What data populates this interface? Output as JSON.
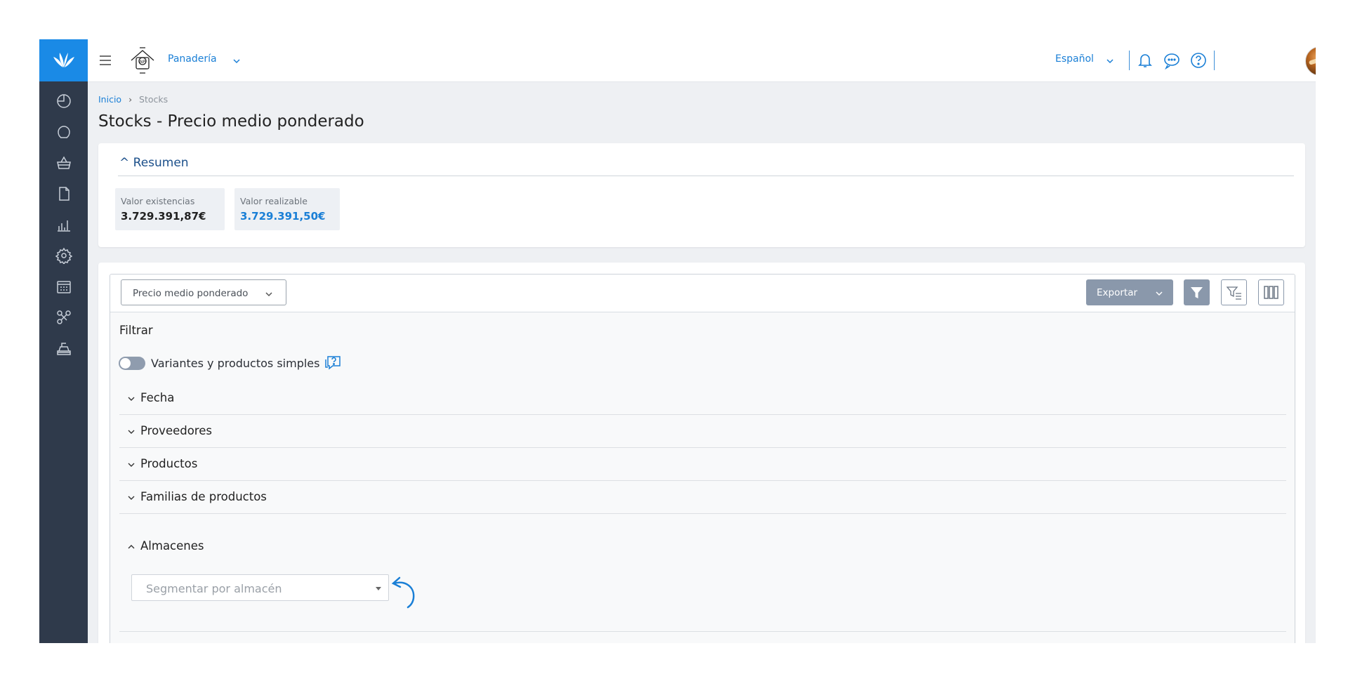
{
  "topbar": {
    "company": "Panadería",
    "language": "Español"
  },
  "breadcrumb": {
    "home": "Inicio",
    "separator": "›",
    "current": "Stocks"
  },
  "page": {
    "title": "Stocks - Precio medio ponderado"
  },
  "summary": {
    "toggle_label": "^ Resumen",
    "stats": [
      {
        "label": "Valor existencias",
        "value": "3.729.391,87€",
        "color": "#222222"
      },
      {
        "label": "Valor realizable",
        "value": "3.729.391,50€",
        "color": "#1a7fd6"
      }
    ]
  },
  "toolbar": {
    "report_select": "Precio medio ponderado",
    "export_label": "Exportar"
  },
  "filters": {
    "title": "Filtrar",
    "toggle_label": "Variantes y productos simples",
    "sections": [
      "Fecha",
      "Proveedores",
      "Productos",
      "Familias de productos",
      "Almacenes"
    ],
    "warehouse_placeholder": "Segmentar por almacén"
  },
  "colors": {
    "brand": "#1a8ae6",
    "sidebar": "#2f3a4b",
    "link": "#1a7fd6",
    "export_button": "#8a98ab"
  },
  "icons": {
    "sidebar": [
      "dashboard-icon",
      "user-icon",
      "basket-icon",
      "document-icon",
      "reports-icon",
      "settings-icon",
      "calendar-icon",
      "integrations-icon",
      "pos-icon"
    ]
  }
}
